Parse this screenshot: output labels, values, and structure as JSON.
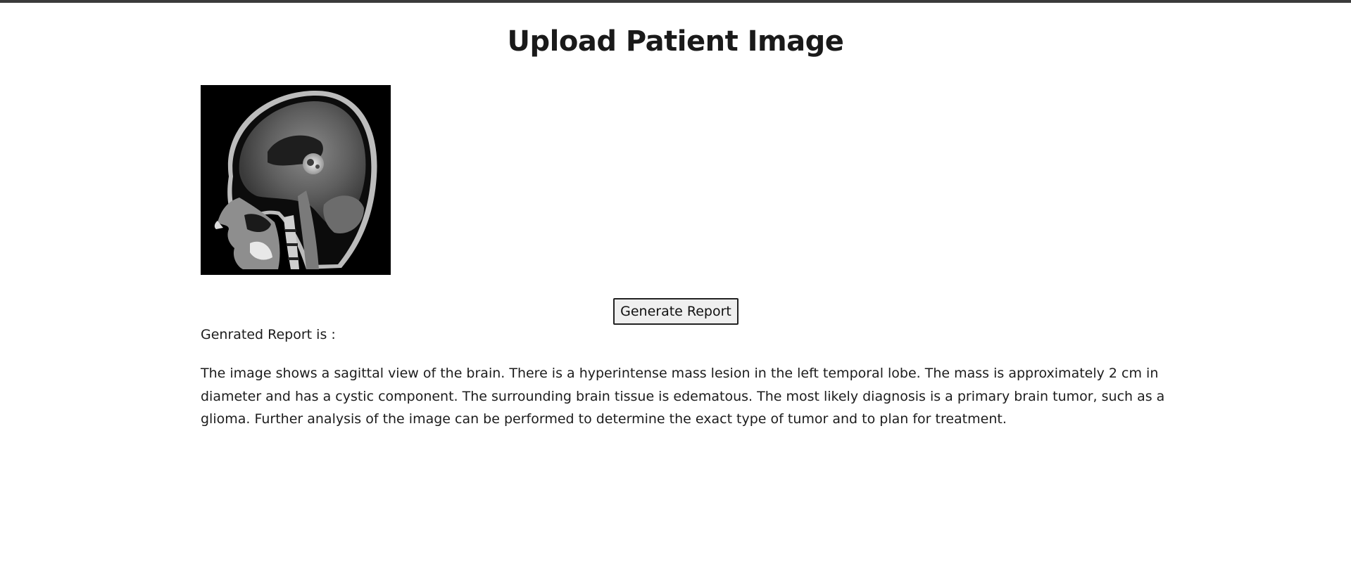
{
  "page": {
    "title": "Upload Patient Image"
  },
  "image": {
    "description_icon": "brain-mri-sagittal-image"
  },
  "actions": {
    "generate_label": "Generate Report"
  },
  "report": {
    "label": "Genrated Report is :",
    "text": "The image shows a sagittal view of the brain. There is a hyperintense mass lesion in the left temporal lobe. The mass is approximately 2 cm in diameter and has a cystic component. The surrounding brain tissue is edematous. The most likely diagnosis is a primary brain tumor, such as a glioma. Further analysis of the image can be performed to determine the exact type of tumor and to plan for treatment."
  },
  "colors": {
    "topbar": "#3a3a3a",
    "text": "#1c1c1c",
    "button_bg": "#efefef"
  }
}
